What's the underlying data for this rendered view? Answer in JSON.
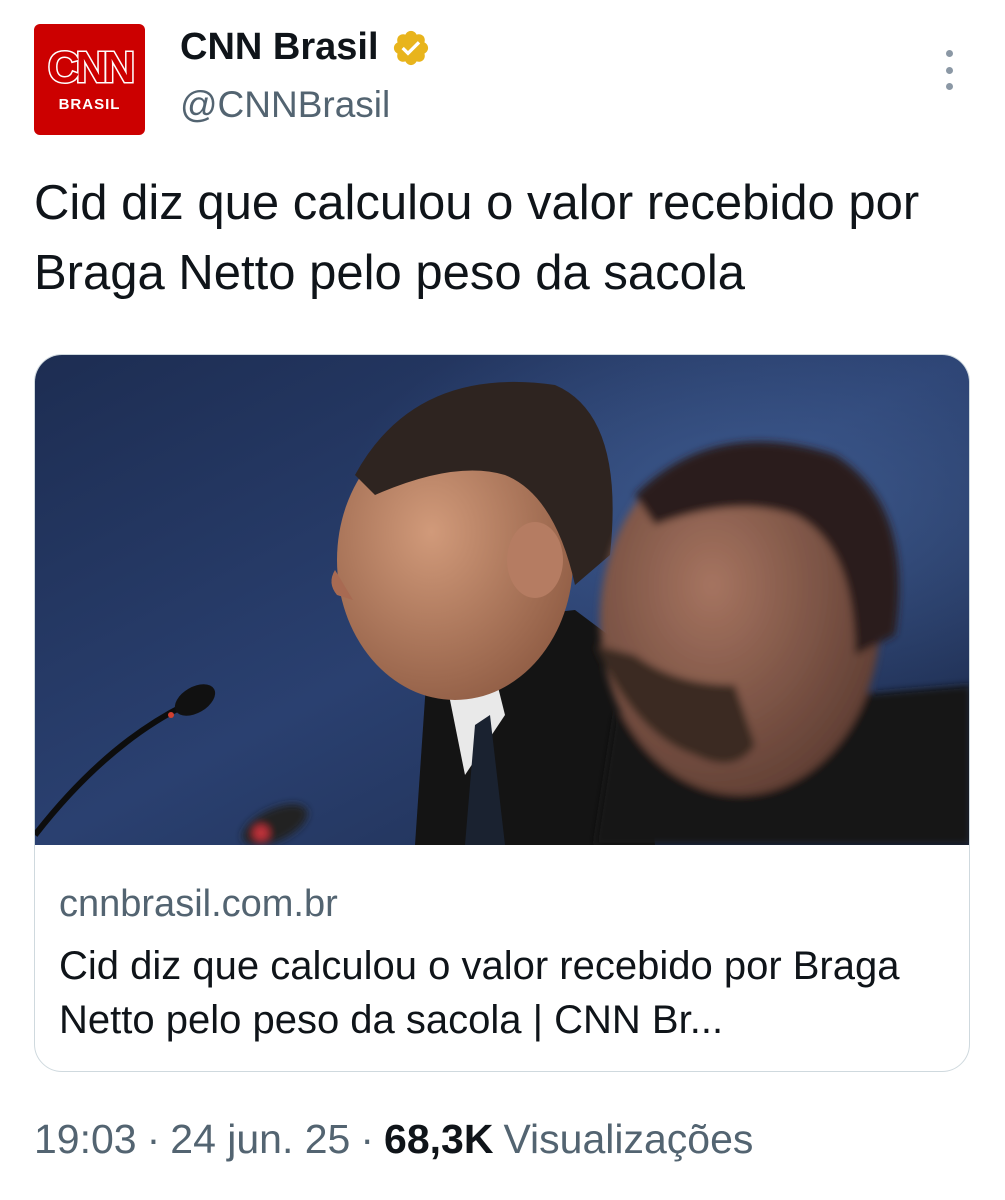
{
  "account": {
    "avatar_logo": "CNN",
    "avatar_sub": "BRASIL",
    "display_name": "CNN Brasil",
    "handle": "@CNNBrasil",
    "verified_icon": "gold-verified-badge-icon"
  },
  "tweet": {
    "text": "Cid diz que calculou o valor recebido por Braga Netto pelo peso da sacola"
  },
  "link_card": {
    "domain": "cnnbrasil.com.br",
    "title": "Cid diz que calculou o valor recebido por Braga Netto pelo peso da sacola | CNN Br..."
  },
  "meta": {
    "time": "19:03",
    "date": "24 jun. 25",
    "separator": "·",
    "views_count": "68,3K",
    "views_label": "Visualizações"
  },
  "colors": {
    "brand_red": "#cc0000",
    "verified_gold": "#e8b41c",
    "secondary_text": "#536471",
    "border": "#cfd9de"
  }
}
